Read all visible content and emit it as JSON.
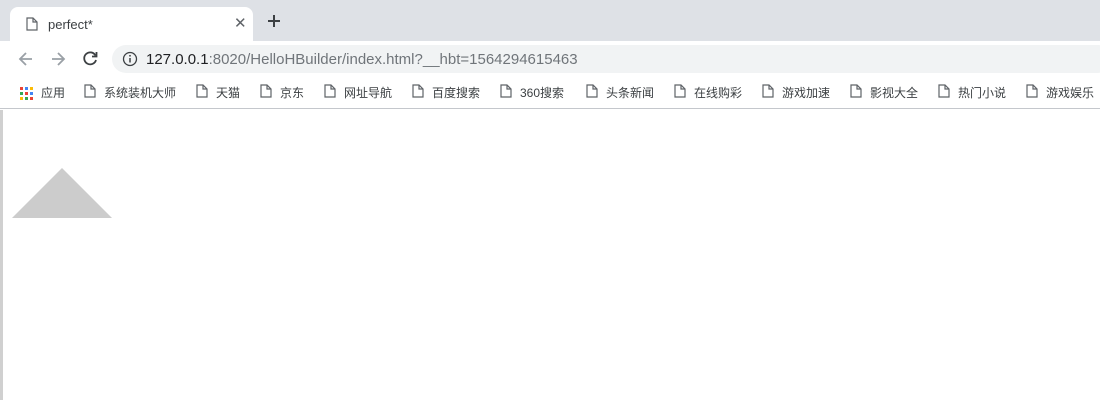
{
  "tab": {
    "title": "perfect*",
    "close_glyph": "✕"
  },
  "toolbar": {
    "url_host": "127.0.0.1",
    "url_rest": ":8020/HelloHBuilder/index.html?__hbt=1564294615463"
  },
  "bookmarks": {
    "apps_label": "应用",
    "apps_colors": [
      "#ea4335",
      "#4285f4",
      "#fbbc05",
      "#34a853",
      "#ea4335",
      "#4285f4",
      "#fbbc05",
      "#34a853",
      "#ea4335"
    ],
    "items": [
      {
        "label": "系统装机大师"
      },
      {
        "label": "天猫"
      },
      {
        "label": "京东"
      },
      {
        "label": "网址导航"
      },
      {
        "label": "百度搜索"
      },
      {
        "label": "360搜索"
      },
      {
        "label": "头条新闻"
      },
      {
        "label": "在线购彩"
      },
      {
        "label": "游戏加速"
      },
      {
        "label": "影视大全"
      },
      {
        "label": "热门小说"
      },
      {
        "label": "游戏娱乐"
      }
    ]
  },
  "page": {
    "triangle_color": "#cccccc"
  },
  "theme": {
    "tabstrip_bg": "#dee1e6",
    "omnibox_bg": "#f1f3f4"
  }
}
